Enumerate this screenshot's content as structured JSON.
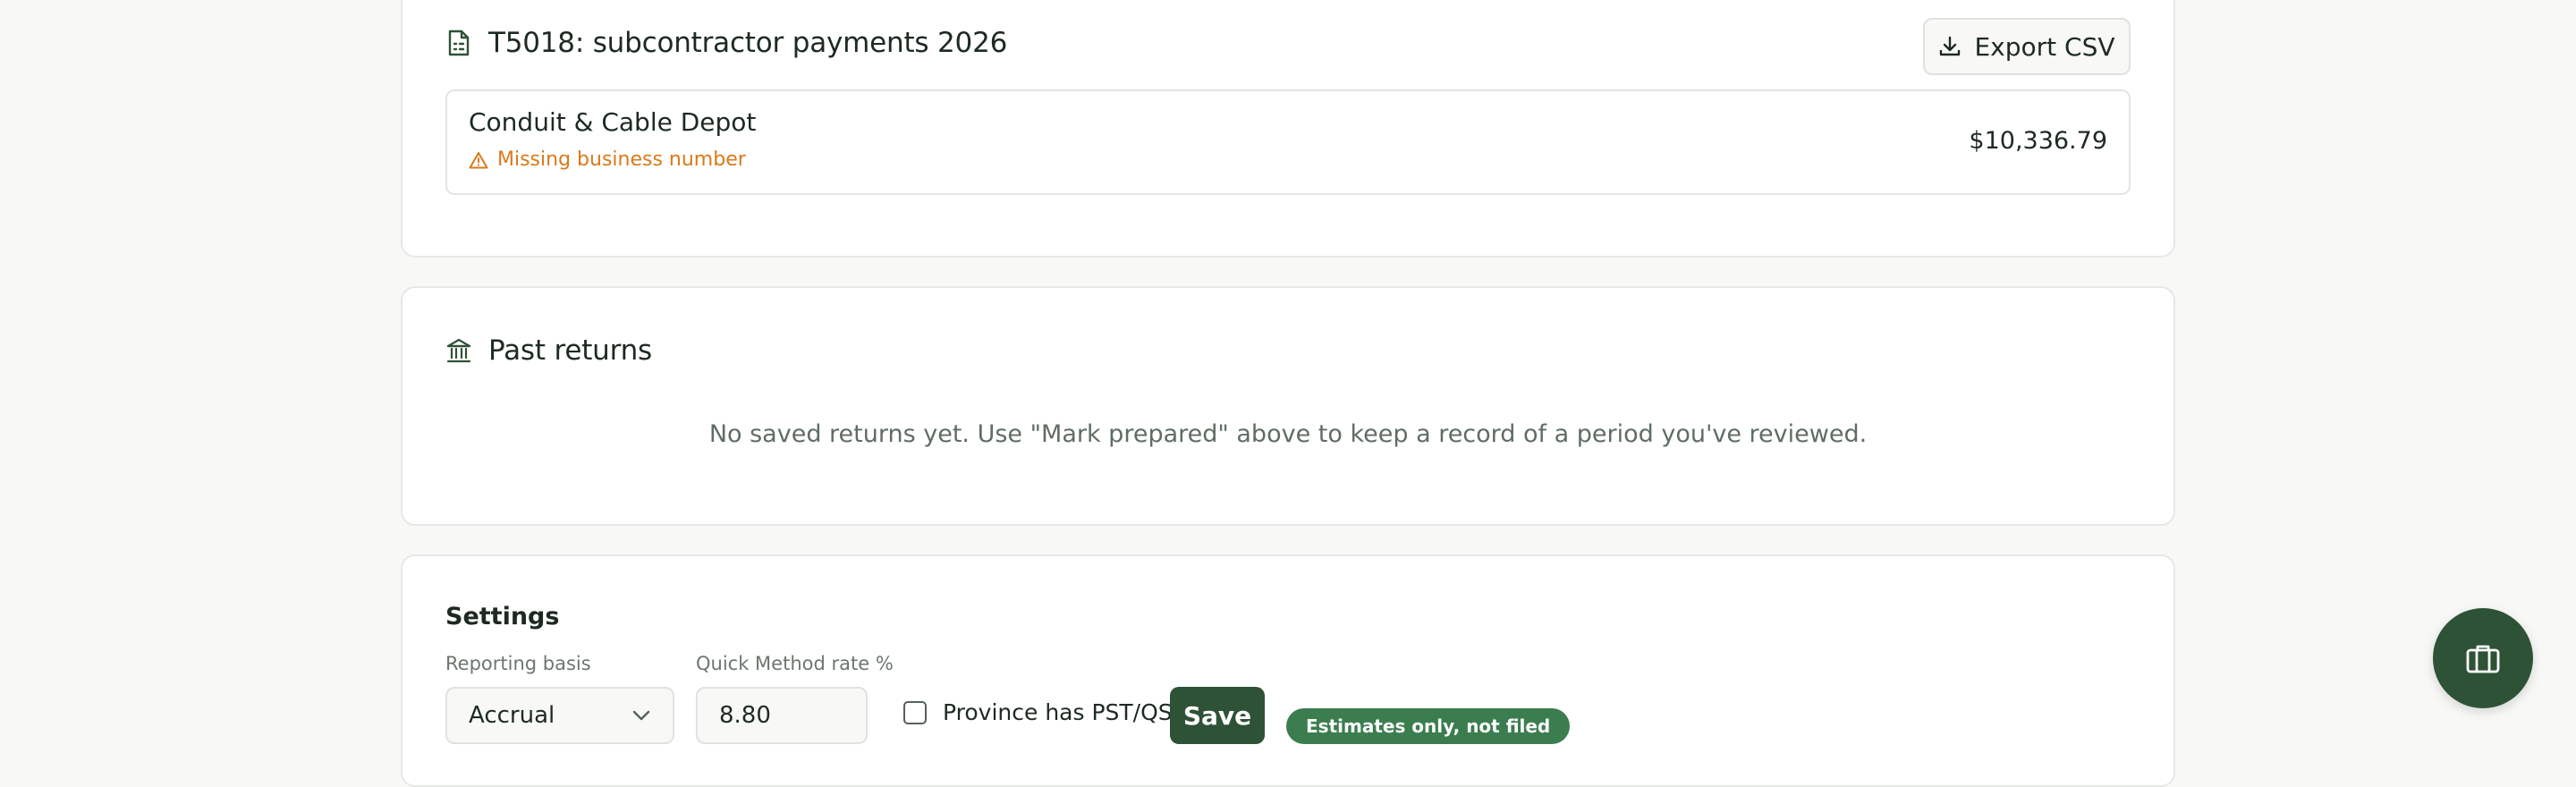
{
  "t5018": {
    "title": "T5018: subcontractor payments 2026",
    "export_label": "Export CSV",
    "vendors": [
      {
        "name": "Conduit & Cable Depot",
        "warning": "Missing business number",
        "amount": "$10,336.79"
      }
    ]
  },
  "past_returns": {
    "title": "Past returns",
    "empty_message": "No saved returns yet. Use \"Mark prepared\" above to keep a record of a period you've reviewed."
  },
  "settings": {
    "title": "Settings",
    "reporting_basis_label": "Reporting basis",
    "reporting_basis_value": "Accrual",
    "quick_method_label": "Quick Method rate %",
    "quick_method_value": "8.80",
    "province_checkbox_label": "Province has PST/QST",
    "province_checked": false,
    "save_label": "Save",
    "badge": "Estimates only, not filed"
  },
  "colors": {
    "primary": "#2e5236",
    "badge": "#3b7d4f",
    "warning": "#d97a1a",
    "muted_text": "#5f6d63"
  },
  "icons": {
    "t5018": "receipt-icon",
    "export": "download-icon",
    "warning": "warning-triangle-icon",
    "past_returns": "bank-icon",
    "select": "chevron-down-icon",
    "fab": "briefcase-icon"
  }
}
